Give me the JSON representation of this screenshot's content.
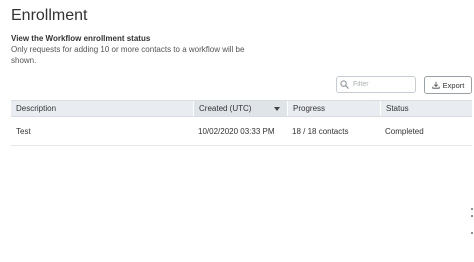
{
  "header": {
    "title": "Enrollment",
    "subtitle": "View the Workflow enrollment status",
    "description": "Only requests for adding 10 or more contacts to a workflow will be shown."
  },
  "toolbar": {
    "filter_placeholder": "Filter",
    "filter_value": "",
    "export_label": "Export",
    "filter_icon": "search-icon",
    "export_icon": "download-icon"
  },
  "table": {
    "columns": [
      {
        "label": "Description"
      },
      {
        "label": "Created (UTC)",
        "sorted": "descending"
      },
      {
        "label": "Progress"
      },
      {
        "label": "Status"
      }
    ],
    "rows": [
      {
        "description": "Test",
        "created": "10/02/2020 03:33 PM",
        "progress": "18 / 18 contacts",
        "status": "Completed"
      }
    ]
  },
  "colors": {
    "header_bg": "#e9edf1",
    "sorted_header_bg": "#dfe4e9",
    "border": "#d8dde2",
    "text": "#333333"
  }
}
